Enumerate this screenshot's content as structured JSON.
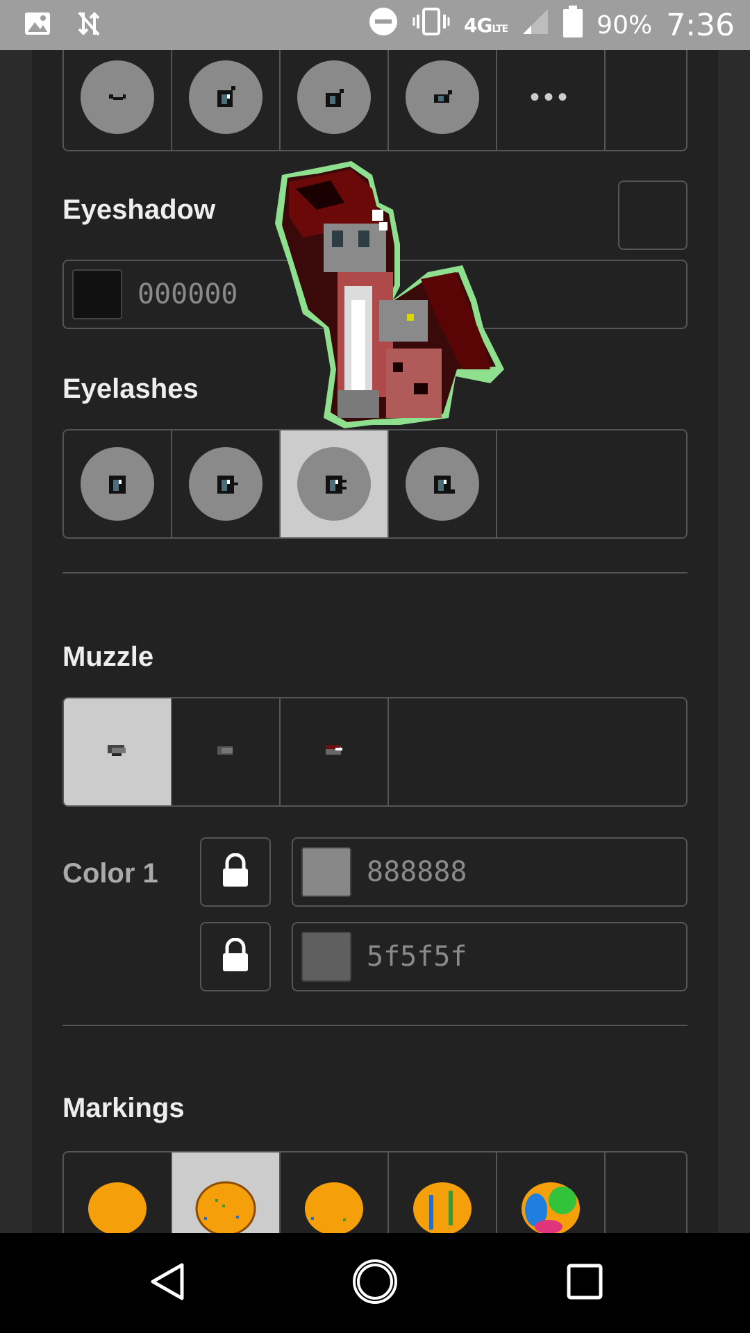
{
  "status_bar": {
    "network": "4G",
    "network_sub": "LTE",
    "battery_percent": "90%",
    "time": "7:36"
  },
  "eyes_grid": {
    "more_label": "•••"
  },
  "eyeshadow": {
    "title": "Eyeshadow",
    "color_hex": "000000",
    "swatch_color": "#111111"
  },
  "eyelashes": {
    "title": "Eyelashes",
    "selected_index": 2
  },
  "muzzle": {
    "title": "Muzzle",
    "selected_index": 0,
    "color_label": "Color 1",
    "color1_hex": "888888",
    "color1_swatch": "#888888",
    "color2_hex": "5f5f5f",
    "color2_swatch": "#5f5f5f"
  },
  "markings": {
    "title": "Markings",
    "selected_index": 1
  }
}
